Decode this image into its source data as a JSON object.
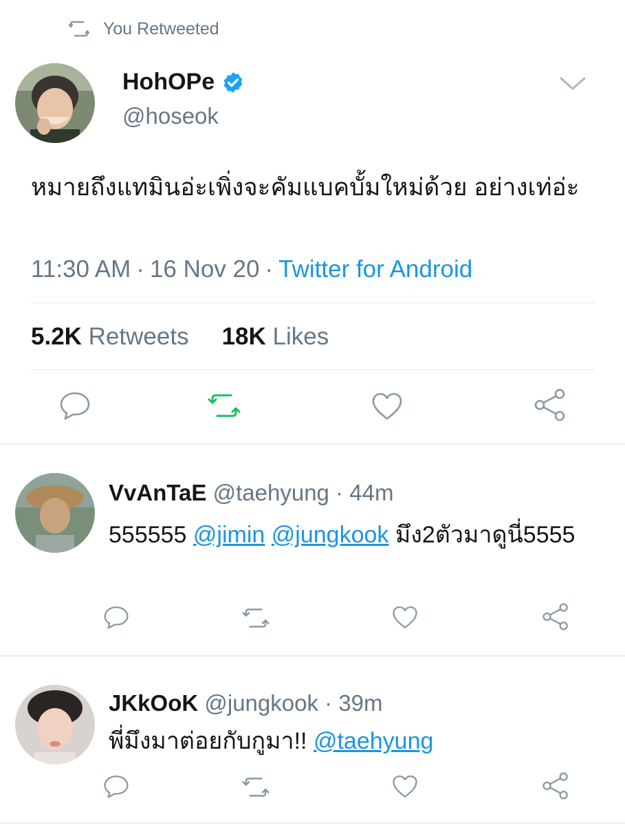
{
  "retweet_header": {
    "label": "You Retweeted"
  },
  "main_tweet": {
    "display_name": "HohOPe",
    "handle": "@hoseok",
    "text": "หมายถึงแทมินอ่ะเพิ่งจะคัมแบคบั้มใหม่ด้วย อย่างเท่อ่ะ",
    "time": "11:30 AM",
    "date": "16 Nov 20",
    "source": "Twitter for Android",
    "retweets_count": "5.2K",
    "retweets_label": "Retweets",
    "likes_count": "18K",
    "likes_label": "Likes",
    "retweeted_color": "#17bf63"
  },
  "replies": [
    {
      "display_name": "VvAnTaE",
      "handle": "@taehyung",
      "age": "44m",
      "text_prefix": "555555",
      "mention_1": "@jimin",
      "mention_2": "@jungkook",
      "text_suffix": "มึง2ตัวมาดูนี่5555"
    },
    {
      "display_name": "JKkOoK",
      "handle": "@jungkook",
      "age": "39m",
      "text_prefix": "พี่มึงมาต่อยกับกูมา!!",
      "mention_1": "@taehyung"
    }
  ],
  "separator": "·",
  "icons": [
    "retweet-icon",
    "verified-badge-icon",
    "chevron-down-icon",
    "reply-icon",
    "like-icon",
    "share-icon"
  ]
}
